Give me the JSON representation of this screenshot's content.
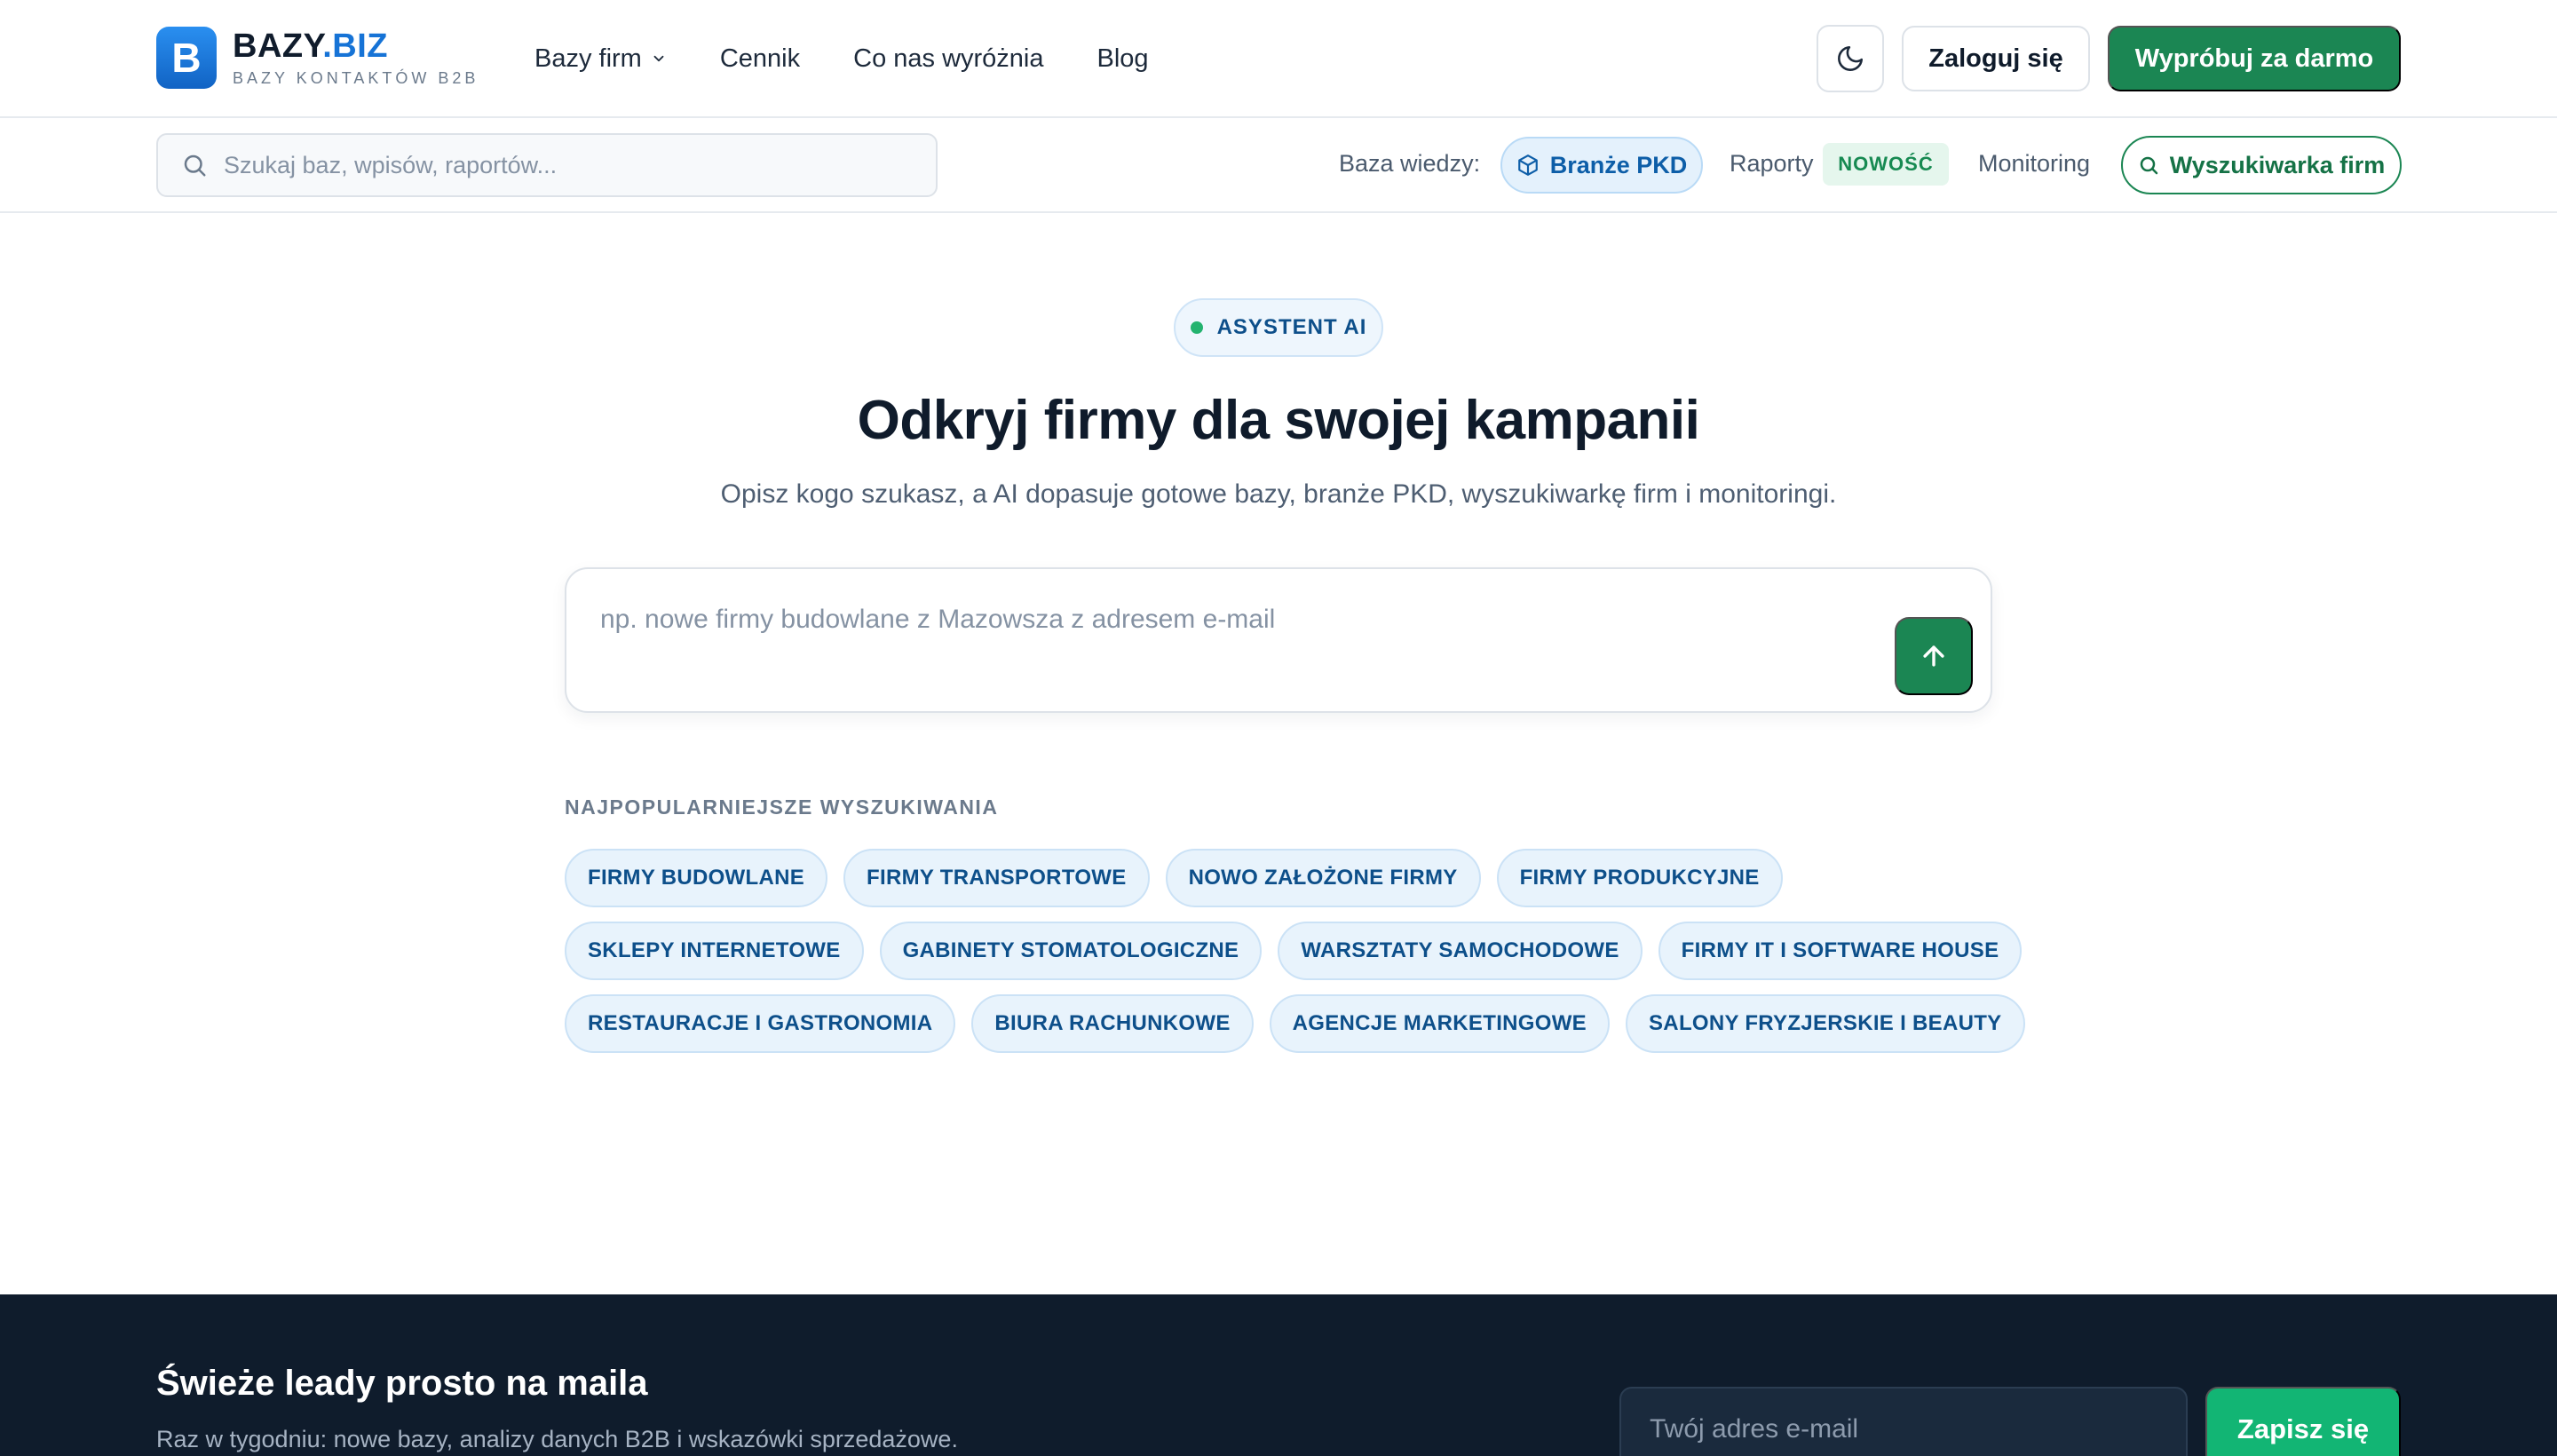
{
  "brand": {
    "logo_letter": "B",
    "name_main": "BAZY",
    "name_accent": ".BIZ",
    "tagline": "BAZY KONTAKTÓW B2B",
    "primary_color": "#1b8653",
    "accent_blue": "#1673d6"
  },
  "nav": {
    "items": [
      {
        "label": "Bazy firm",
        "has_dropdown": true
      },
      {
        "label": "Cennik"
      },
      {
        "label": "Co nas wyróżnia"
      },
      {
        "label": "Blog"
      }
    ]
  },
  "header": {
    "theme_icon": "moon-icon",
    "login_label": "Zaloguj się",
    "try_label": "Wypróbuj za darmo"
  },
  "subbar": {
    "search_placeholder": "Szukaj baz, wpisów, raportów...",
    "kb_label": "Baza wiedzy:",
    "pkd_label": "Branże PKD",
    "reports_label": "Raporty",
    "new_badge": "NOWOŚĆ",
    "monitoring_label": "Monitoring",
    "company_search_label": "Wyszukiwarka firm"
  },
  "hero": {
    "badge": "ASYSTENT AI",
    "title": "Odkryj firmy dla swojej kampanii",
    "subtitle": "Opisz kogo szukasz, a AI dopasuje gotowe bazy, branże PKD, wyszukiwarkę firm i monitoringi.",
    "prompt_placeholder": "np. nowe firmy budowlane z Mazowsza z adresem e-mail",
    "popular_label": "NAJPOPULARNIEJSZE WYSZUKIWANIA",
    "chip_rows": [
      [
        "FIRMY BUDOWLANE",
        "FIRMY TRANSPORTOWE",
        "NOWO ZAŁOŻONE FIRMY",
        "FIRMY PRODUKCYJNE"
      ],
      [
        "SKLEPY INTERNETOWE",
        "GABINETY STOMATOLOGICZNE",
        "WARSZTATY SAMOCHODOWE",
        "FIRMY IT I SOFTWARE HOUSE"
      ],
      [
        "RESTAURACJE I GASTRONOMIA",
        "BIURA RACHUNKOWE",
        "AGENCJE MARKETINGOWE",
        "SALONY FRYZJERSKIE I BEAUTY"
      ]
    ]
  },
  "footer": {
    "title": "Świeże leady prosto na maila",
    "subtitle": "Raz w tygodniu: nowe bazy, analizy danych B2B i wskazówki sprzedażowe.",
    "email_placeholder": "Twój adres e-mail",
    "subscribe_label": "Zapisz się"
  }
}
